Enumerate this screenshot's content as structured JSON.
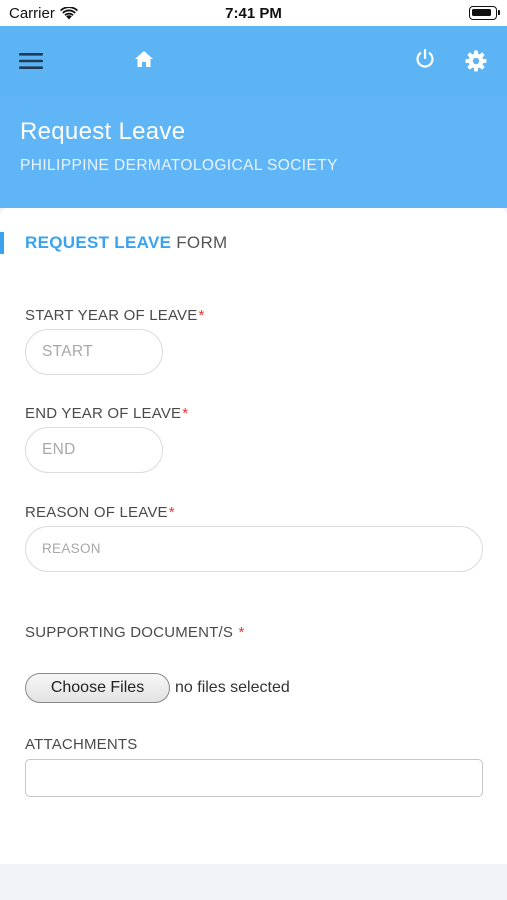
{
  "status_bar": {
    "carrier": "Carrier",
    "time": "7:41 PM"
  },
  "app_bar": {
    "menu_icon": "hamburger-menu-icon",
    "home_icon": "home-icon",
    "power_icon": "power-icon",
    "settings_icon": "gear-icon",
    "color": "#5cb4f5"
  },
  "header": {
    "title": "Request Leave",
    "subtitle": "PHILIPPINE DERMATOLOGICAL SOCIETY"
  },
  "form": {
    "title_highlight": "REQUEST LEAVE",
    "title_rest": "FORM",
    "accent_color": "#3aa3ef",
    "required_marker": "*",
    "start_year": {
      "label": "START YEAR OF LEAVE",
      "placeholder": "START",
      "value": ""
    },
    "end_year": {
      "label": "END YEAR OF LEAVE",
      "placeholder": "END",
      "value": ""
    },
    "reason": {
      "label": "REASON OF LEAVE",
      "placeholder": "REASON",
      "value": ""
    },
    "supporting_docs": {
      "label": "SUPPORTING DOCUMENT/S",
      "button_label": "Choose Files",
      "status": "no files selected"
    },
    "attachments": {
      "label": "ATTACHMENTS",
      "value": ""
    }
  }
}
